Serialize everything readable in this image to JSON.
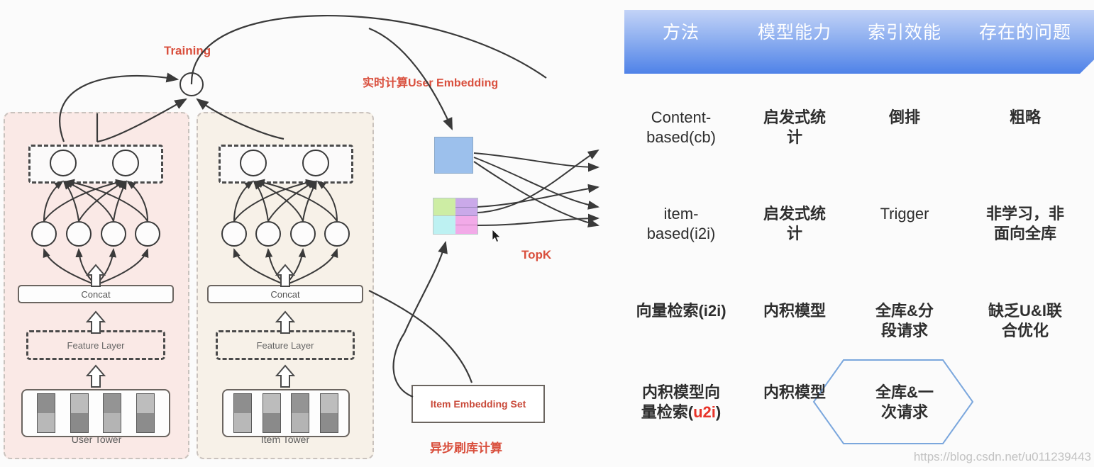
{
  "diagram": {
    "labels": {
      "training": "Training",
      "realtime_user_embedding": "实时计算User Embedding",
      "topk": "TopK",
      "async_refresh": "异步刷库计算",
      "item_embedding_set": "Item Embedding Set"
    },
    "user_tower": {
      "name": "User Tower",
      "concat": "Concat",
      "feature_layer": "Feature Layer",
      "output_nodes": 2,
      "hidden_nodes": 4,
      "input_bars": 4
    },
    "item_tower": {
      "name": "Item Tower",
      "concat": "Concat",
      "feature_layer": "Feature Layer",
      "output_nodes": 2,
      "hidden_nodes": 4,
      "input_bars": 4
    },
    "colors": {
      "user_tower_bg": "#fae9e6",
      "item_tower_bg": "#f7f1e8",
      "user_embedding": "#9cc0ec",
      "green": "#cdeda4",
      "purple": "#caa9e9",
      "cyan": "#bdf1f2",
      "pink": "#f2aae8",
      "red_text": "#d94f3d"
    },
    "result_cells": [
      "#f3aaee",
      "#cdeda4",
      "#caa9e9",
      "#bdf1f2"
    ]
  },
  "table": {
    "headers": [
      "方法",
      "模型能力",
      "索引效能",
      "存在的问题"
    ],
    "rows": [
      {
        "method_line1": "Content-",
        "method_line2": "based(cb)",
        "capability_line1": "启发式统",
        "capability_line2": "计",
        "index_line1": "倒排",
        "index_line2": "",
        "problem_line1": "粗略",
        "problem_line2": ""
      },
      {
        "method_line1": "item-",
        "method_line2": "based(i2i)",
        "capability_line1": "启发式统",
        "capability_line2": "计",
        "index_line1": "Trigger",
        "index_line2": "",
        "problem_line1": "非学习，非",
        "problem_line2": "面向全库"
      },
      {
        "method_line1": "向量检索(i2i)",
        "method_line2": "",
        "capability_line1": "内积模型",
        "capability_line2": "",
        "index_line1": "全库&分",
        "index_line2": "段请求",
        "problem_line1": "缺乏U&I联",
        "problem_line2": "合优化"
      },
      {
        "method_line1": "内积模型向",
        "method_line2": "量检索(",
        "method_highlight": "u2i",
        "method_line2_tail": ")",
        "capability_line1": "内积模型",
        "capability_line2": "",
        "index_line1": "全库&一",
        "index_line2": "次请求",
        "problem_line1": "",
        "problem_line2": ""
      }
    ],
    "highlight_shape": "hexagon",
    "highlight_color": "#7ba7dd"
  },
  "watermark": "https://blog.csdn.net/u011239443"
}
